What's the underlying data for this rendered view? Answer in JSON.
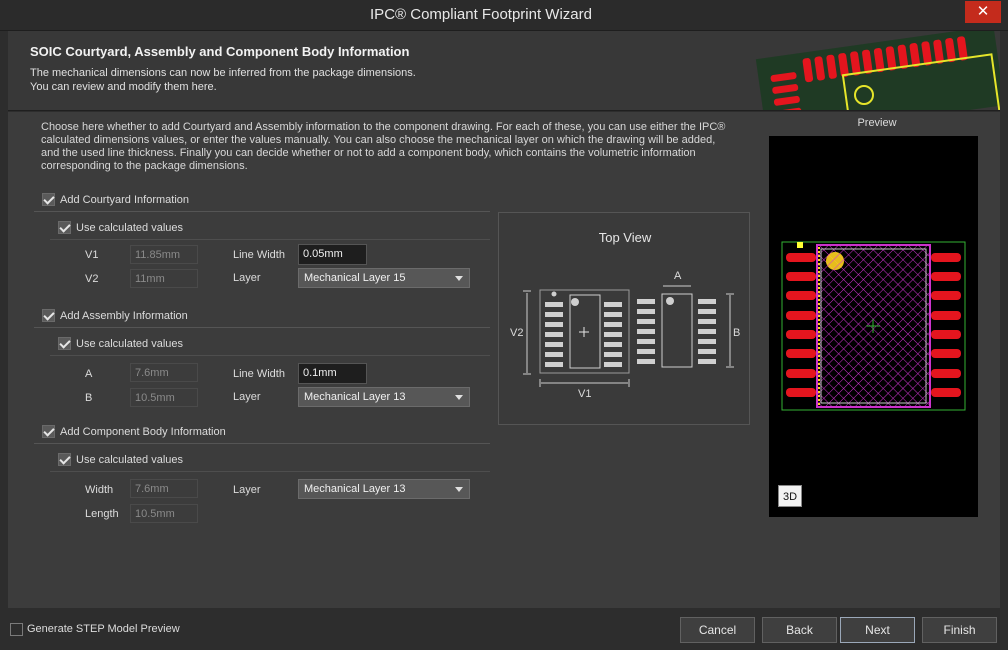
{
  "window": {
    "title": "IPC® Compliant Footprint Wizard",
    "close_glyph": "✕"
  },
  "header": {
    "title": "SOIC Courtyard, Assembly and Component Body Information",
    "description": "The mechanical dimensions can now be inferred from the package dimensions.\nYou can review and modify them here."
  },
  "intro": "Choose here whether to add Courtyard and Assembly information to the component drawing. For each of these, you can use either the IPC® calculated dimensions values, or enter the values manually. You can also choose the mechanical layer on which the drawing will be added, and the used line thickness. Finally you can decide whether or not to add a component body, which contains the volumetric information corresponding to the package dimensions.",
  "courtyard": {
    "label": "Add Courtyard Information",
    "checked": true,
    "use_calc_label": "Use calculated values",
    "v1_label": "V1",
    "v1_value": "11.85mm",
    "v2_label": "V2",
    "v2_value": "11mm",
    "line_width_label": "Line Width",
    "line_width_value": "0.05mm",
    "layer_label": "Layer",
    "layer_value": "Mechanical Layer 15"
  },
  "assembly": {
    "label": "Add Assembly Information",
    "checked": true,
    "use_calc_label": "Use calculated values",
    "a_label": "A",
    "a_value": "7.6mm",
    "b_label": "B",
    "b_value": "10.5mm",
    "line_width_label": "Line Width",
    "line_width_value": "0.1mm",
    "layer_label": "Layer",
    "layer_value": "Mechanical Layer 13"
  },
  "body": {
    "label": "Add Component Body Information",
    "checked": true,
    "use_calc_label": "Use calculated values",
    "width_label": "Width",
    "width_value": "7.6mm",
    "length_label": "Length",
    "length_value": "10.5mm",
    "layer_label": "Layer",
    "layer_value": "Mechanical Layer 13"
  },
  "top_view": {
    "title": "Top View",
    "v1": "V1",
    "v2": "V2",
    "a": "A",
    "b": "B"
  },
  "preview": {
    "label": "Preview",
    "btn_3d": "3D"
  },
  "footer": {
    "step_preview_label": "Generate STEP Model Preview",
    "cancel": "Cancel",
    "back": "Back",
    "next": "Next",
    "finish": "Finish"
  },
  "colors": {
    "pad": "#e4151e",
    "outline": "#33b233",
    "body": "#cc33cc",
    "close": "#c42b1c"
  }
}
